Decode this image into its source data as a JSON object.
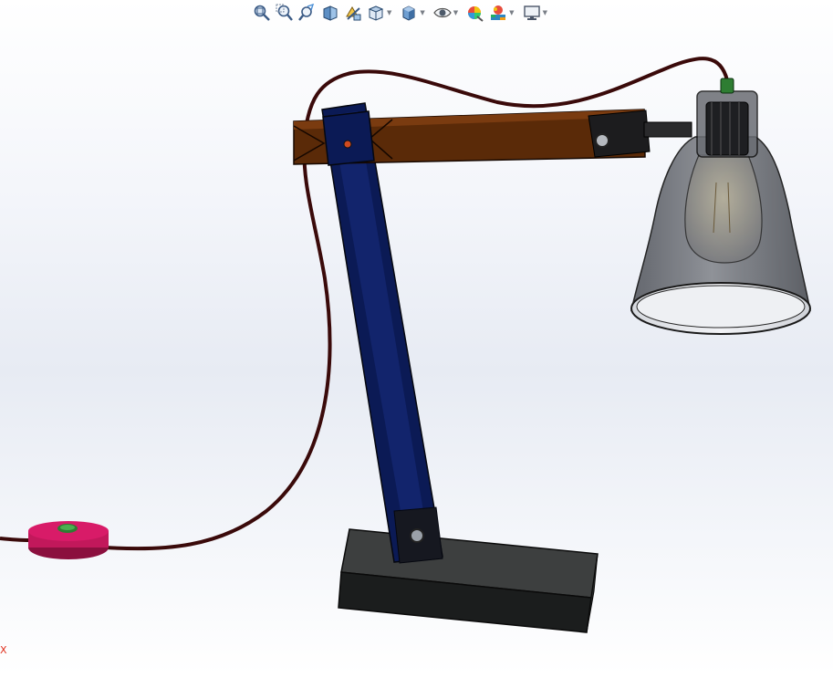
{
  "toolbar": {
    "items": [
      {
        "icon": "zoom-to-fit-icon",
        "dropdown": false
      },
      {
        "icon": "zoom-to-area-icon",
        "dropdown": false
      },
      {
        "icon": "previous-view-icon",
        "dropdown": false
      },
      {
        "icon": "section-view-icon",
        "dropdown": false
      },
      {
        "icon": "dynamic-annotation-view-icon",
        "dropdown": false
      },
      {
        "icon": "view-orientation-icon",
        "dropdown": true
      },
      {
        "icon": "display-style-icon",
        "dropdown": true
      },
      {
        "icon": "hide-show-items-icon",
        "dropdown": true
      },
      {
        "icon": "edit-appearance-icon",
        "dropdown": false
      },
      {
        "icon": "apply-scene-icon",
        "dropdown": true
      },
      {
        "icon": "view-settings-icon",
        "dropdown": true
      }
    ],
    "caret": "▼"
  },
  "triad": {
    "axis_label": "X",
    "color": "#e0301e"
  },
  "colors": {
    "arm": "#5a2a08",
    "post": "#0b1a55",
    "base": "#1b1d1d",
    "switch": "#c2185b",
    "cord": "#3a0a0a",
    "shade": "#6d7077"
  }
}
